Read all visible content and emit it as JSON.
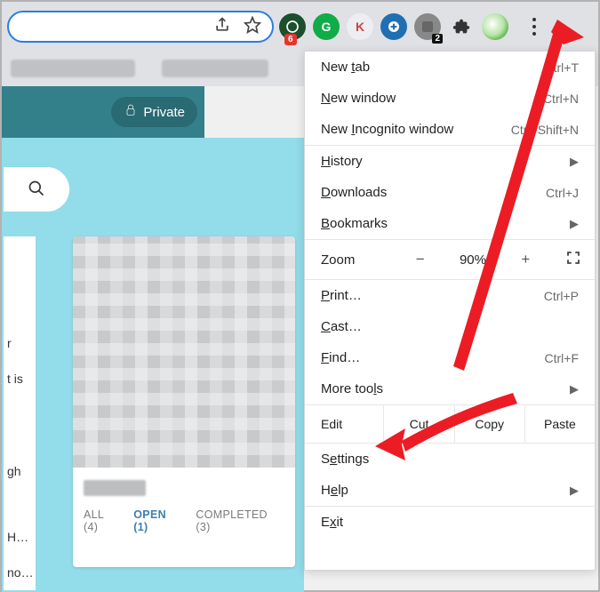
{
  "toolbar": {
    "ext_badge_a": "6",
    "ext_letter_b": "G",
    "ext_letter_c": "K",
    "ext_badge_e": "2"
  },
  "header": {
    "private_label": "Private"
  },
  "left_panel": {
    "line1": "r",
    "line2": "t is",
    "line3": "gh",
    "line4": " H…",
    "line5": "no…"
  },
  "tabs": {
    "all_label": "ALL (4)",
    "open_label": "OPEN (1)",
    "completed_label": "COMPLETED (3)"
  },
  "menu": {
    "new_tab": "New tab",
    "new_tab_key": "Ctrl+T",
    "new_window": "New window",
    "new_window_key": "Ctrl+N",
    "incognito": "New Incognito window",
    "incognito_key": "Ctrl+Shift+N",
    "history": "History",
    "downloads": "Downloads",
    "downloads_key": "Ctrl+J",
    "bookmarks": "Bookmarks",
    "zoom_label": "Zoom",
    "zoom_minus": "−",
    "zoom_value": "90%",
    "zoom_plus": "+",
    "print": "Print…",
    "print_key": "Ctrl+P",
    "cast": "Cast…",
    "find": "Find…",
    "find_key": "Ctrl+F",
    "more_tools": "More tools",
    "edit": "Edit",
    "cut": "Cut",
    "copy": "Copy",
    "paste": "Paste",
    "settings": "Settings",
    "help": "Help",
    "exit": "Exit"
  }
}
